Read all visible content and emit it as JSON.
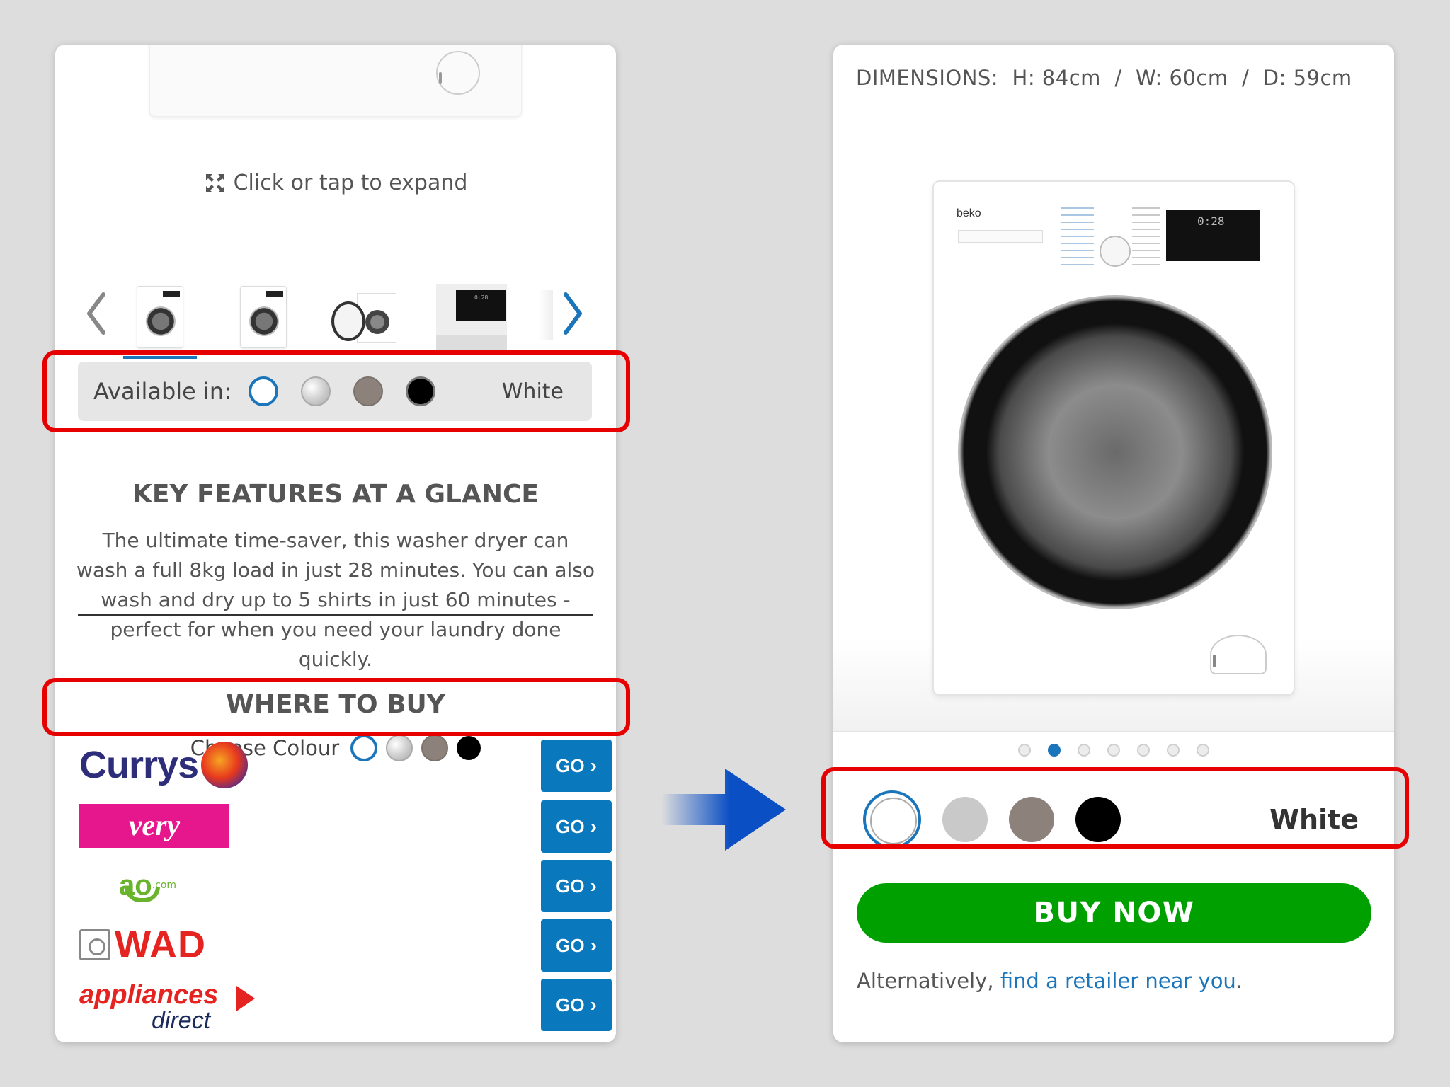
{
  "left": {
    "expand_text": "Click or tap to expand",
    "thumbnails": [
      "front-view",
      "angled-view",
      "door-open-view",
      "display-closeup"
    ],
    "available": {
      "label": "Available in:",
      "selected_value": "White",
      "swatches": [
        "white",
        "silver",
        "grey",
        "black"
      ]
    },
    "key_features": {
      "title": "KEY FEATURES AT A GLANCE",
      "body": "The ultimate time-saver, this washer dryer can wash a full 8kg load in just 28 minutes. You can also wash and dry up to 5 shirts in just 60 minutes - perfect for when you need your laundry done quickly."
    },
    "where_to_buy": {
      "title": "WHERE TO BUY",
      "choose_label": "Choose Colour",
      "retailers": [
        {
          "name": "Currys",
          "go": "GO"
        },
        {
          "name": "very",
          "go": "GO"
        },
        {
          "name": "ao.com",
          "go": "GO"
        },
        {
          "name": "WAD",
          "go": "GO"
        },
        {
          "name": "appliances direct",
          "go": "GO"
        }
      ]
    }
  },
  "right": {
    "dimensions": "DIMENSIONS:  H: 84cm  /  W: 60cm  /  D: 59cm",
    "display_time": "0:28",
    "brand": "beko",
    "carousel_dots": 7,
    "carousel_active": 2,
    "selected_colour": "White",
    "swatches": [
      "white",
      "silver",
      "grey",
      "black"
    ],
    "buy_now": "BUY NOW",
    "alt_prefix": "Alternatively, ",
    "alt_link": "find a retailer near you",
    "alt_suffix": "."
  },
  "colors": {
    "accent_blue": "#1b75bb",
    "go_blue": "#0a78bd",
    "buy_green": "#00a000",
    "highlight_red": "#e60000",
    "swatch_grey": "#8c827b"
  }
}
